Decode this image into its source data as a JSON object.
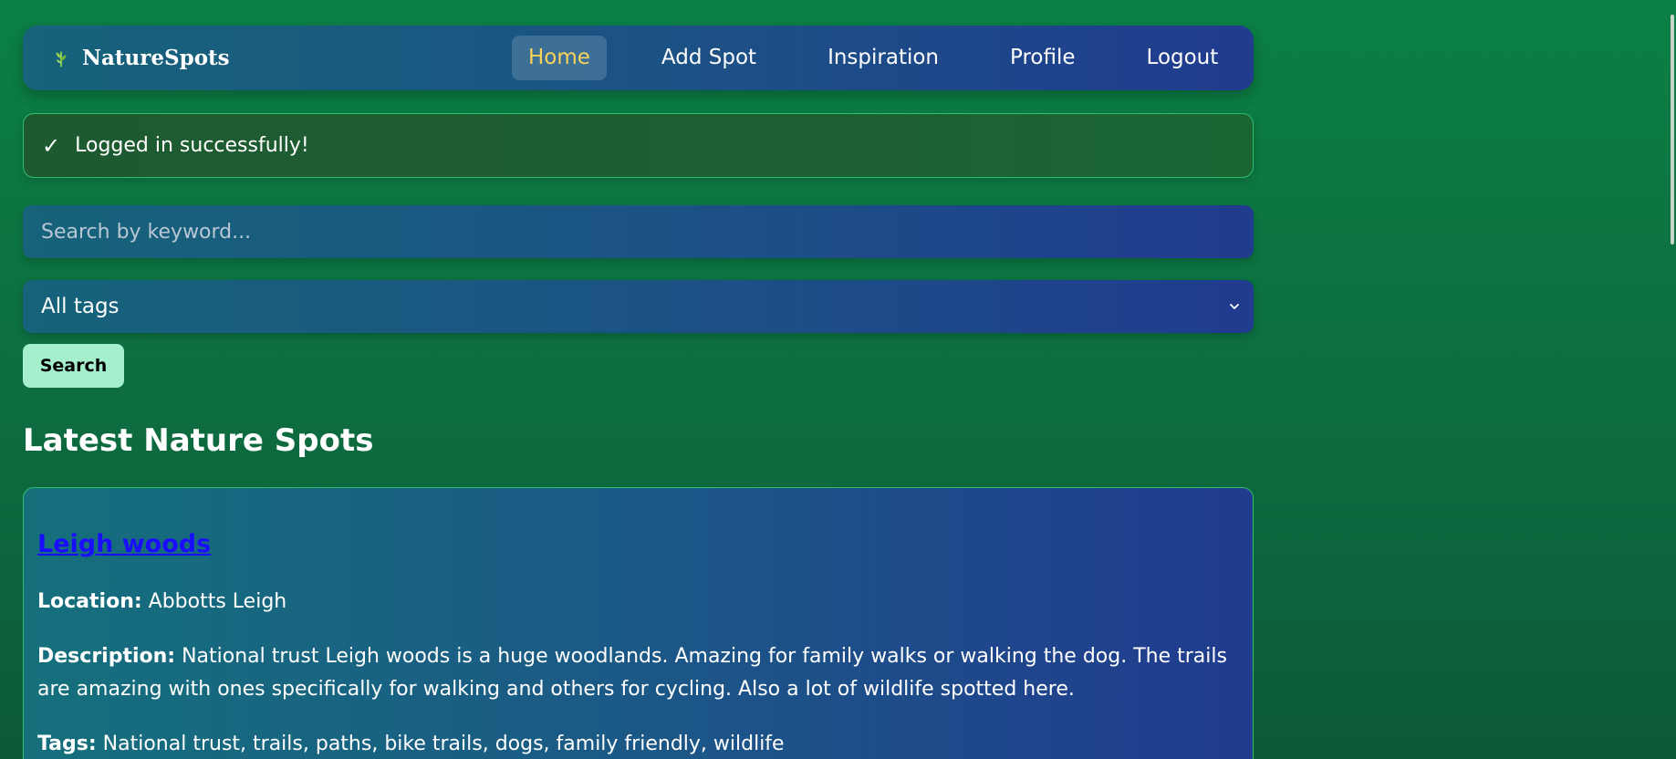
{
  "nav": {
    "brand_icon": "leaf-icon",
    "brand_name": "NatureSpots",
    "links": [
      {
        "label": "Home",
        "active": true
      },
      {
        "label": "Add Spot",
        "active": false
      },
      {
        "label": "Inspiration",
        "active": false
      },
      {
        "label": "Profile",
        "active": false
      },
      {
        "label": "Logout",
        "active": false
      }
    ]
  },
  "alert": {
    "icon": "checkmark-icon",
    "icon_glyph": "✓",
    "message": "Logged in successfully!"
  },
  "search": {
    "placeholder": "Search by keyword...",
    "value": ""
  },
  "tag_filter": {
    "selected": "All tags",
    "icon": "chevron-down-icon"
  },
  "search_button": {
    "label": "Search"
  },
  "section": {
    "title": "Latest Nature Spots"
  },
  "spots": [
    {
      "title": "Leigh woods",
      "location_label": "Location:",
      "location": "Abbotts Leigh",
      "description_label": "Description:",
      "description": "National trust Leigh woods is a huge woodlands. Amazing for family walks or walking the dog. The trails are amazing with ones specifically for walking and others for cycling. Also a lot of wildlife spotted here.",
      "tags_label": "Tags:",
      "tags": "National trust, trails, paths, bike trails, dogs, family friendly, wildlife"
    }
  ],
  "colors": {
    "accent_active": "#f7d35a",
    "button_bg": "#a5efcd",
    "border_green": "#2fbf6a",
    "link_blue": "#1a0dff"
  }
}
